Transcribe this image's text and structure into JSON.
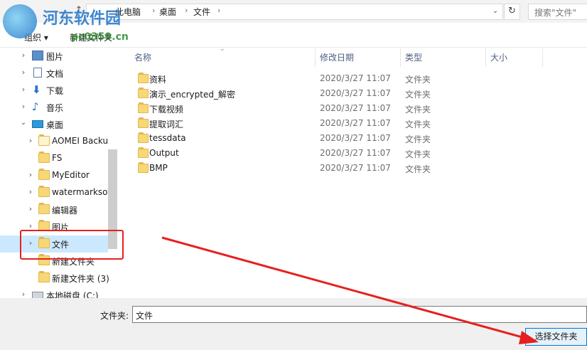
{
  "address_bar": {
    "crumbs": [
      "此电脑",
      "桌面",
      "文件"
    ],
    "search_placeholder": "搜索\"文件\""
  },
  "toolbar": {
    "organize_label": "组织",
    "new_folder_label": "新建文件夹"
  },
  "tree": {
    "items": [
      {
        "label": "图片",
        "icon": "pictures-icon",
        "expandable": true
      },
      {
        "label": "文档",
        "icon": "documents-icon",
        "expandable": true
      },
      {
        "label": "下载",
        "icon": "downloads-icon",
        "expandable": true
      },
      {
        "label": "音乐",
        "icon": "music-icon",
        "expandable": true
      },
      {
        "label": "桌面",
        "icon": "desktop-icon",
        "expandable": true,
        "expanded": true
      },
      {
        "label": "AOMEI Backu",
        "icon": "folder-icon",
        "expandable": true
      },
      {
        "label": "FS",
        "icon": "folder-icon",
        "expandable": false
      },
      {
        "label": "MyEditor",
        "icon": "folder-icon",
        "expandable": true
      },
      {
        "label": "watermarksof",
        "icon": "folder-icon",
        "expandable": true
      },
      {
        "label": "编辑器",
        "icon": "folder-icon",
        "expandable": true
      },
      {
        "label": "图片",
        "icon": "folder-icon",
        "expandable": true
      },
      {
        "label": "文件",
        "icon": "folder-icon",
        "expandable": true,
        "selected": true
      },
      {
        "label": "新建文件夹",
        "icon": "folder-icon",
        "expandable": false
      },
      {
        "label": "新建文件夹 (3)",
        "icon": "folder-icon",
        "expandable": false
      },
      {
        "label": "本地磁盘 (C:)",
        "icon": "drive-icon",
        "expandable": true
      }
    ]
  },
  "columns": {
    "name": "名称",
    "date": "修改日期",
    "type": "类型",
    "size": "大小"
  },
  "files": [
    {
      "name": "资料",
      "date": "2020/3/27 11:07",
      "type": "文件夹"
    },
    {
      "name": "演示_encrypted_解密",
      "date": "2020/3/27 11:07",
      "type": "文件夹"
    },
    {
      "name": "下载视频",
      "date": "2020/3/27 11:07",
      "type": "文件夹"
    },
    {
      "name": "提取词汇",
      "date": "2020/3/27 11:07",
      "type": "文件夹"
    },
    {
      "name": "tessdata",
      "date": "2020/3/27 11:07",
      "type": "文件夹"
    },
    {
      "name": "Output",
      "date": "2020/3/27 11:07",
      "type": "文件夹"
    },
    {
      "name": "BMP",
      "date": "2020/3/27 11:07",
      "type": "文件夹"
    }
  ],
  "footer": {
    "folder_label": "文件夹:",
    "folder_value": "文件",
    "select_button": "选择文件夹"
  },
  "watermark": {
    "site_name": "河东软件园",
    "site_url": "pc0359.cn"
  },
  "colors": {
    "selection": "#cce8ff",
    "accent": "#0078d7",
    "annotation": "#e62020"
  }
}
